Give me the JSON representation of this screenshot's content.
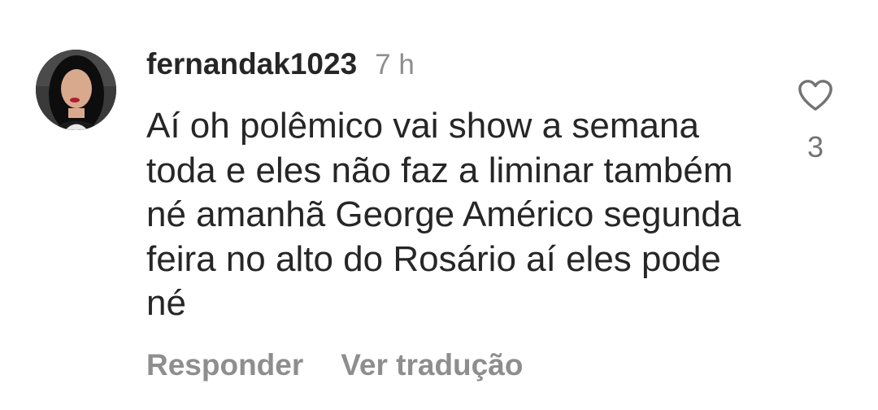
{
  "comment": {
    "username": "fernandak1023",
    "timestamp": "7 h",
    "text": "Aí oh polêmico vai show a semana toda e eles não faz a liminar também né amanhã George Américo segunda feira no alto do Rosário aí eles pode né",
    "like_icon": "heart-outline-icon",
    "like_count": "3",
    "reply_label": "Responder",
    "translate_label": "Ver tradução"
  },
  "colors": {
    "text": "#262626",
    "secondary": "#8e8e8e",
    "background": "#ffffff"
  }
}
